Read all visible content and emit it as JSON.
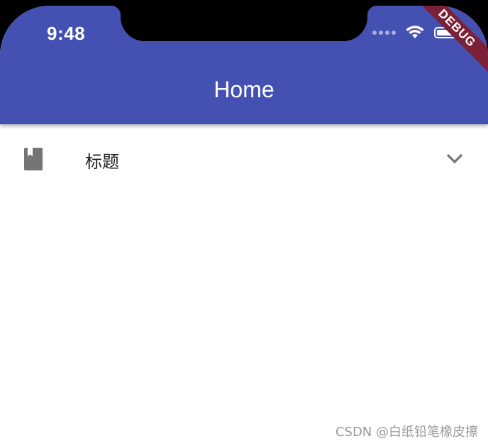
{
  "status_bar": {
    "time": "9:48"
  },
  "app_bar": {
    "title": "Home",
    "background_color": "#4451b3",
    "debug_banner": "DEBUG"
  },
  "expansion_tile": {
    "leading_icon": "book-icon",
    "title": "标题",
    "trailing_icon": "chevron-down-icon",
    "expanded": false
  },
  "watermark": "CSDN @白纸铅笔橡皮擦"
}
